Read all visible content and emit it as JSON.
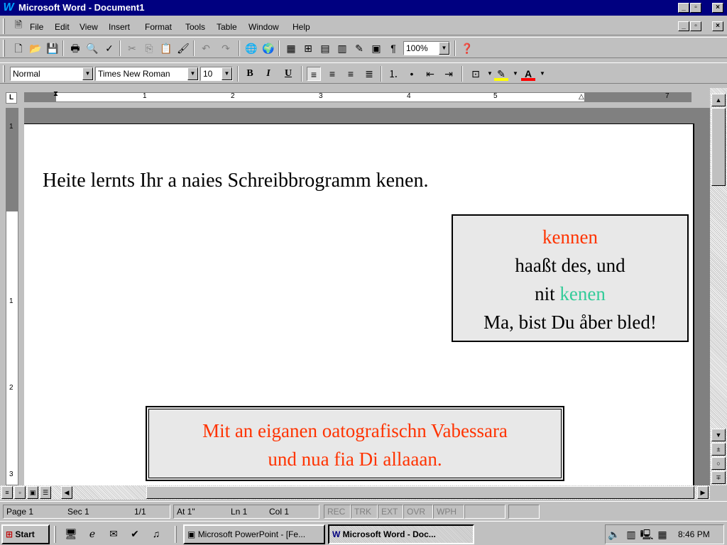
{
  "window": {
    "title": "Microsoft Word - Document1",
    "caption_buttons": [
      "_",
      "▫",
      "×"
    ]
  },
  "menu": {
    "items": [
      "File",
      "Edit",
      "View",
      "Insert",
      "Format",
      "Tools",
      "Table",
      "Window",
      "Help"
    ]
  },
  "toolbar_standard": {
    "zoom": "100%"
  },
  "toolbar_format": {
    "style": "Normal",
    "font": "Times New Roman",
    "size": "10",
    "bold": "B",
    "italic": "I",
    "underline": "U"
  },
  "ruler": {
    "numbers": [
      "1",
      "2",
      "3",
      "4",
      "5",
      "7"
    ],
    "vertical_numbers": [
      "1",
      "1",
      "2",
      "3"
    ]
  },
  "document": {
    "line1": "Heite lernts Ihr a naies Schreibbrogramm kenen.",
    "box1": {
      "word1": "kennen",
      "line2": "haaßt des, und",
      "line3_prefix": "nit",
      "line3_word": "kenen",
      "line4": "Ma, bist Du åber bled!"
    },
    "box2": {
      "line1": "Mit an eiganen oatografischn Vabessara",
      "line2": "und nua fia Di allaaan."
    }
  },
  "colors": {
    "red_text": "#ff3300",
    "green_text": "#33cc99",
    "title_bar": "#000080"
  },
  "status": {
    "page": "Page 1",
    "sec": "Sec 1",
    "count": "1/1",
    "at": "At 1\"",
    "ln": "Ln 1",
    "col": "Col 1",
    "rec": "REC",
    "trk": "TRK",
    "ext": "EXT",
    "ovr": "OVR",
    "wph": "WPH"
  },
  "taskbar": {
    "start": "Start",
    "task1": "Microsoft PowerPoint - [Fe...",
    "task2": "Microsoft Word - Doc...",
    "time": "8:46 PM"
  }
}
